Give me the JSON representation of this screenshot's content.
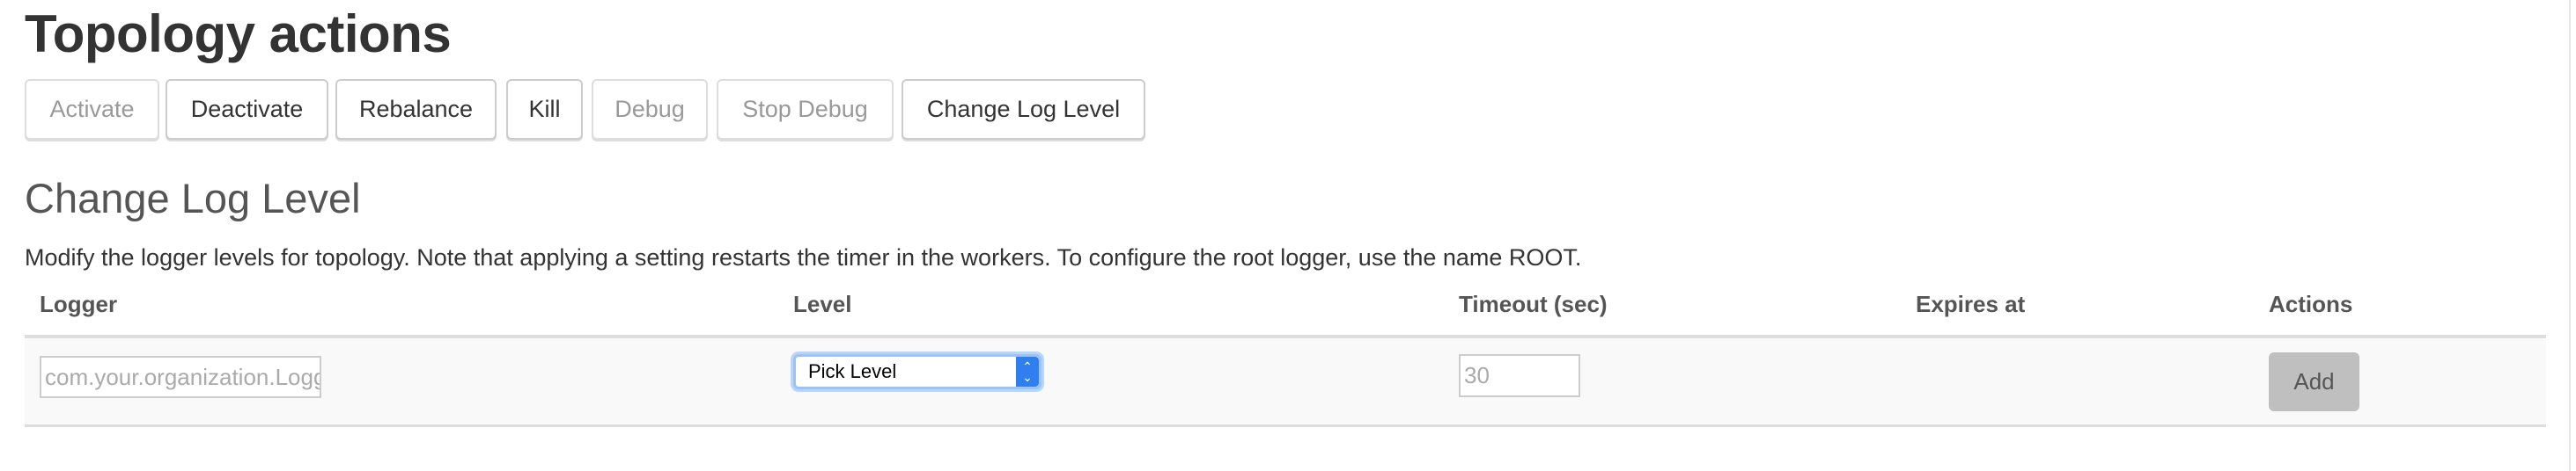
{
  "page_title": "Topology actions",
  "actions": [
    {
      "label": "Activate",
      "enabled": false
    },
    {
      "label": "Deactivate",
      "enabled": true
    },
    {
      "label": "Rebalance",
      "enabled": true
    },
    {
      "label": "Kill",
      "enabled": true
    },
    {
      "label": "Debug",
      "enabled": false
    },
    {
      "label": "Stop Debug",
      "enabled": false
    },
    {
      "label": "Change Log Level",
      "enabled": true
    }
  ],
  "log_level": {
    "heading": "Change Log Level",
    "description": "Modify the logger levels for topology. Note that applying a setting restarts the timer in the workers. To configure the root logger, use the name ROOT.",
    "columns": [
      "Logger",
      "Level",
      "Timeout (sec)",
      "Expires at",
      "Actions"
    ],
    "row": {
      "logger_placeholder": "com.your.organization.LoggerName",
      "level_selected": "Pick Level",
      "timeout_placeholder": "30",
      "expires_at": "",
      "add_label": "Add"
    }
  },
  "colors": {
    "select_accent": "#2f7ff0",
    "add_button_bg": "#bfbfbf"
  }
}
